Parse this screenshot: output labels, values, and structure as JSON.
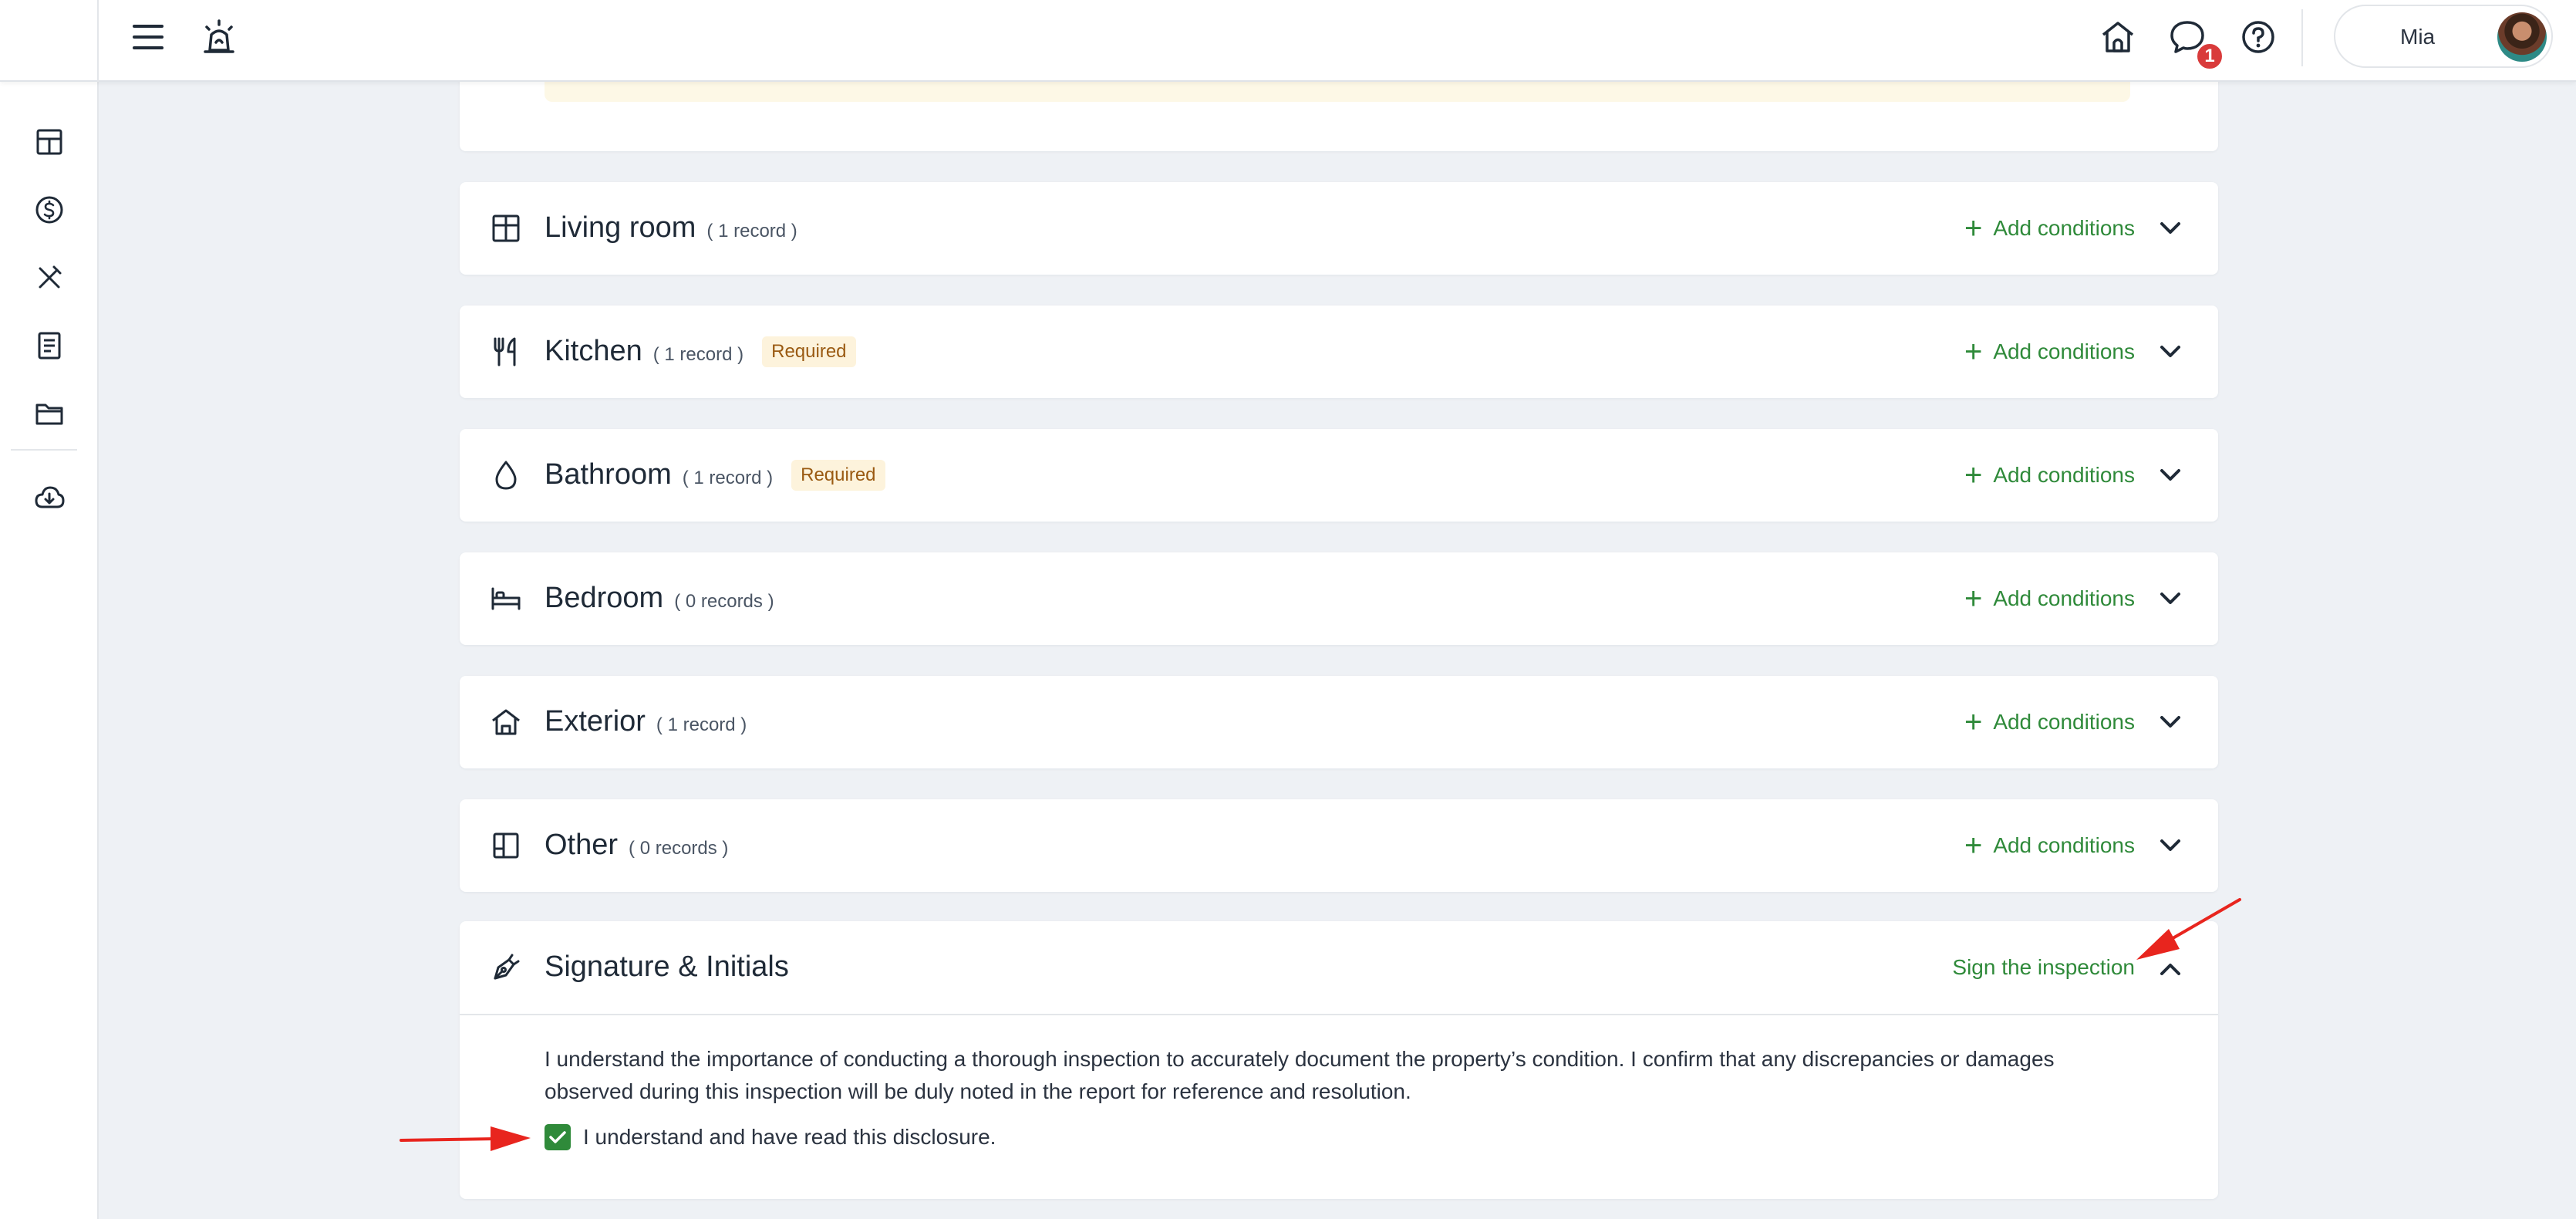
{
  "topbar": {
    "user_name": "Mia",
    "chat_badge": "1"
  },
  "sidebar": {
    "items": [
      {
        "icon": "dashboard-icon"
      },
      {
        "icon": "dollar-icon"
      },
      {
        "icon": "tools-icon"
      },
      {
        "icon": "document-icon"
      },
      {
        "icon": "folder-icon"
      },
      {
        "icon": "cloud-download-icon"
      }
    ]
  },
  "sections": [
    {
      "name": "Living room",
      "count": "( 1 record )",
      "required": "",
      "action": "Add conditions"
    },
    {
      "name": "Kitchen",
      "count": "( 1 record )",
      "required": "Required",
      "action": "Add conditions"
    },
    {
      "name": "Bathroom",
      "count": "( 1 record )",
      "required": "Required",
      "action": "Add conditions"
    },
    {
      "name": "Bedroom",
      "count": "( 0 records )",
      "required": "",
      "action": "Add conditions"
    },
    {
      "name": "Exterior",
      "count": "( 1 record )",
      "required": "",
      "action": "Add conditions"
    },
    {
      "name": "Other",
      "count": "( 0 records )",
      "required": "",
      "action": "Add conditions"
    }
  ],
  "signature": {
    "title": "Signature & Initials",
    "action": "Sign the inspection",
    "disclosure": "I understand the importance of conducting a thorough inspection to accurately document the property’s condition. I confirm that any discrepancies or damages observed during this inspection will be duly noted in the report for reference and resolution.",
    "checkbox_label": "I understand and have read this disclosure.",
    "checked": true
  },
  "colors": {
    "accent_green": "#2f8a3a",
    "required_bg": "#fdf3dc",
    "required_text": "#9a5a12",
    "badge_red": "#d93b3b",
    "annotation_red": "#e8251e"
  }
}
